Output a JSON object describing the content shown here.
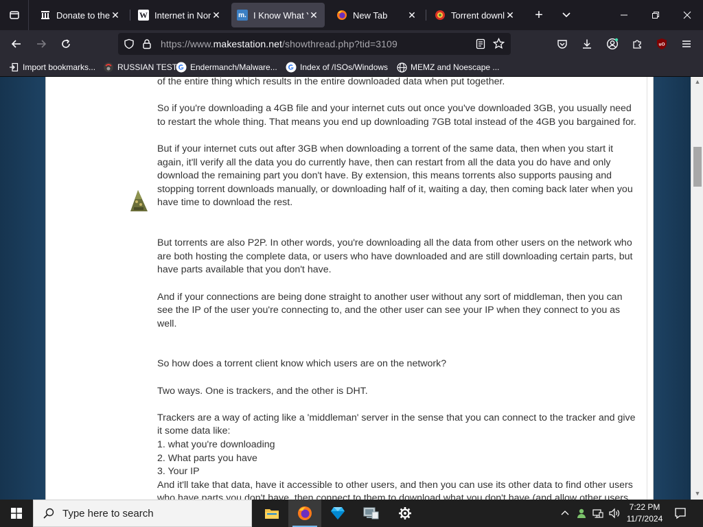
{
  "browser": {
    "tabs": [
      {
        "title": "Donate to the Internet Archive",
        "icon": "archive-icon",
        "favicon_glyph": "",
        "active": false
      },
      {
        "title": "Internet in North Korea",
        "icon": "wikipedia-icon",
        "favicon_glyph": "W",
        "active": false
      },
      {
        "title": "I Know What You Download",
        "icon": "makestation-icon",
        "favicon_glyph": "m.",
        "active": true
      },
      {
        "title": "New Tab",
        "icon": "firefox-icon",
        "favicon_glyph": "",
        "active": false
      },
      {
        "title": "Torrent downloads",
        "icon": "torrent-icon",
        "favicon_glyph": "",
        "active": false
      }
    ],
    "close_glyph": "✕",
    "new_tab_glyph": "+",
    "url_prefix": "https://www.",
    "url_host": "makestation.net",
    "url_path": "/showthread.php?tid=3109",
    "bookmarks": [
      {
        "label": "Import bookmarks...",
        "icon": "import-icon"
      },
      {
        "label": "RUSSIAN TEST",
        "icon": "site-icon"
      },
      {
        "label": "Endermanch/Malware...",
        "icon": "google-icon"
      },
      {
        "label": "Index of /ISOs/Windows",
        "icon": "google-icon"
      },
      {
        "label": "MEMZ and Noescape ...",
        "icon": "globe-icon"
      }
    ]
  },
  "post": {
    "paragraphs": [
      "of the entire thing which results in the entire downloaded data when put together.",
      "So if you're downloading a 4GB file and your internet cuts out once you've downloaded 3GB, you usually need to restart the whole thing. That means you end up downloading 7GB total instead of the 4GB you bargained for.",
      "But if your internet cuts out after 3GB when downloading a torrent of the same data, then when you start it again, it'll verify all the data you do currently have, then can restart from all the data you do have and only download the remaining part you don't have. By extension, this means torrents also supports pausing and stopping torrent downloads manually, or downloading half of it, waiting a day, then coming back later when you have time to download the rest.",
      "But torrents are also P2P. In other words, you're downloading all the data from other users on the network who are both hosting the complete data, or users who have downloaded and are still downloading certain parts, but have parts available that you don't have.",
      "And if your connections are being done straight to another user without any sort of middleman, then you can see the IP of the user you're connecting to, and the other user can see your IP when they connect to you as well.",
      "So how does a torrent client know which users are on the network?",
      "Two ways. One is trackers, and the other is DHT.",
      "Trackers are a way of acting like a 'middleman' server in the sense that you can connect to the tracker and give it some data like:\n1. what you're downloading\n2. What parts you have\n3. Your IP\nAnd it'll take that data, have it accessible to other users, and then you can use its other data to find other users who have parts you don't have, then connect to them to download what you don't have (and allow other users to connect to you to download parts they don't have but parts you do.)"
    ]
  },
  "taskbar": {
    "search_placeholder": "Type here to search",
    "apps": [
      {
        "name": "file-explorer",
        "icon": "folder-icon"
      },
      {
        "name": "firefox",
        "icon": "firefox-icon"
      },
      {
        "name": "gem-app",
        "icon": "diamond-icon"
      },
      {
        "name": "system-app",
        "icon": "computer-icon"
      },
      {
        "name": "settings",
        "icon": "gear-icon"
      }
    ],
    "time": "7:22 PM",
    "date": "11/7/2024"
  },
  "colors": {
    "accent": "#76b9ed",
    "page_bg": "#183a56",
    "chrome_dark": "#1c1b22",
    "chrome": "#2b2a33",
    "ublock": "#800000"
  }
}
